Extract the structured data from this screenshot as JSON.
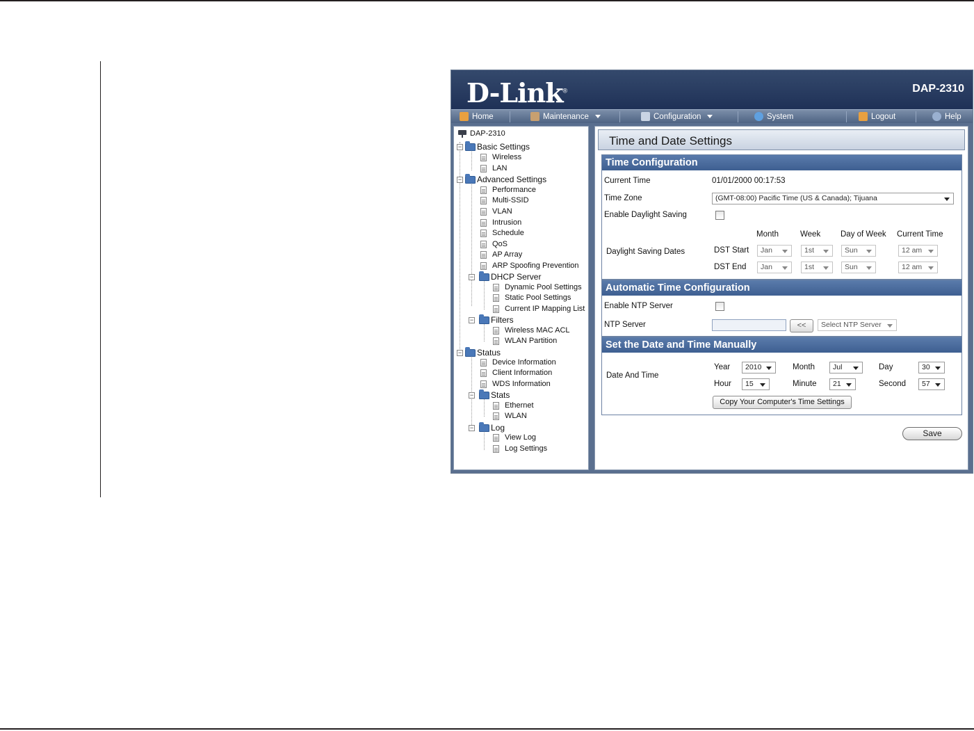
{
  "header": {
    "logo": "D-Link",
    "model": "DAP-2310"
  },
  "menu": {
    "home": "Home",
    "maintenance": "Maintenance",
    "configuration": "Configuration",
    "system": "System",
    "logout": "Logout",
    "help": "Help"
  },
  "tree": {
    "root": "DAP-2310",
    "basic_settings": "Basic Settings",
    "wireless": "Wireless",
    "lan": "LAN",
    "advanced_settings": "Advanced Settings",
    "performance": "Performance",
    "multi_ssid": "Multi-SSID",
    "vlan": "VLAN",
    "intrusion": "Intrusion",
    "schedule": "Schedule",
    "qos": "QoS",
    "ap_array": "AP Array",
    "arp_spoofing": "ARP Spoofing Prevention",
    "dhcp_server": "DHCP Server",
    "dynamic_pool": "Dynamic Pool Settings",
    "static_pool": "Static Pool Settings",
    "ip_mapping": "Current IP Mapping List",
    "filters": "Filters",
    "wireless_mac_acl": "Wireless MAC ACL",
    "wlan_partition": "WLAN Partition",
    "status": "Status",
    "device_information": "Device Information",
    "client_information": "Client Information",
    "wds_information": "WDS Information",
    "stats": "Stats",
    "ethernet": "Ethernet",
    "wlan": "WLAN",
    "log": "Log",
    "view_log": "View Log",
    "log_settings": "Log Settings"
  },
  "page": {
    "title": "Time and Date Settings",
    "time_config": {
      "heading": "Time Configuration",
      "current_time_label": "Current Time",
      "current_time_value": "01/01/2000 00:17:53",
      "time_zone_label": "Time Zone",
      "time_zone_value": "(GMT-08:00) Pacific Time (US & Canada); Tijuana",
      "daylight_saving_label": "Enable Daylight Saving",
      "daylight_saving_checked": false,
      "col_month": "Month",
      "col_week": "Week",
      "col_day_of_week": "Day of Week",
      "col_current_time": "Current Time",
      "dst_dates_label": "Daylight Saving Dates",
      "dst_start_label": "DST Start",
      "dst_end_label": "DST End",
      "start": {
        "month": "Jan",
        "week": "1st",
        "day": "Sun",
        "time": "12 am"
      },
      "end": {
        "month": "Jan",
        "week": "1st",
        "day": "Sun",
        "time": "12 am"
      }
    },
    "auto_time": {
      "heading": "Automatic Time Configuration",
      "enable_ntp_label": "Enable NTP Server",
      "enable_ntp_checked": false,
      "ntp_server_label": "NTP Server",
      "ntp_server_value": "",
      "copy_button": "<<",
      "select_ntp": "Select NTP Server"
    },
    "manual": {
      "heading": "Set the Date and Time Manually",
      "date_time_label": "Date And Time",
      "year_label": "Year",
      "year": "2010",
      "month_label": "Month",
      "month": "Jul",
      "day_label": "Day",
      "day": "30",
      "hour_label": "Hour",
      "hour": "15",
      "minute_label": "Minute",
      "minute": "21",
      "second_label": "Second",
      "second": "57",
      "copy_computer_button": "Copy Your Computer's Time Settings"
    },
    "save_button": "Save"
  },
  "colors": {
    "banner": "#1f3157",
    "section_header": "#4a6b9d",
    "frame": "#5a6f8f"
  }
}
